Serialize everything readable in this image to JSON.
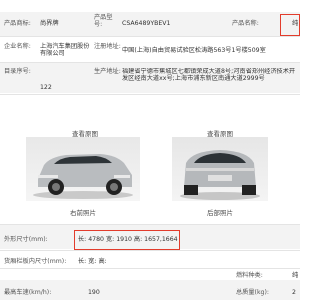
{
  "top": {
    "brand_label": "产品商标:",
    "brand_value": "尚界牌",
    "model_label": "产品型号:",
    "model_value": "CSA6489YBEV1",
    "name_label": "产品名称:",
    "name_value": "纯"
  },
  "company": {
    "company_label": "企业名称:",
    "company_value": "上海汽车集团股份有限公司",
    "address_label": "注册地址:",
    "address_value": "中国(上海)自由贸易试验区松涛路563号1号楼509室"
  },
  "catalog": {
    "catalog_label": "目录序号:",
    "catalog_value": "122",
    "production_label": "生产地址:",
    "production_value": "福建省宁德市蕉城区七都镇荣成大道8号;河南省郑州经济技术开发区经南大道xx号;上海市浦东新区南通大道2999号"
  },
  "images": {
    "view_original_left": "查看原图",
    "view_original_right": "查看原图",
    "caption_left": "右前照片",
    "caption_right": "后部照片"
  },
  "specs": {
    "dimensions_label": "外形尺寸(mm):",
    "dimensions_value": "长: 4780 宽: 1910 高: 1657,1664",
    "cargo_label": "货厢栏板内尺寸(mm):",
    "cargo_value": "长: 宽: 高:",
    "fuel_label": "燃料种类:",
    "fuel_value": "纯",
    "speed_label": "最高车速(km/h):",
    "speed_value": "190",
    "mass_label": "总质量(kg):",
    "mass_value": "2"
  }
}
